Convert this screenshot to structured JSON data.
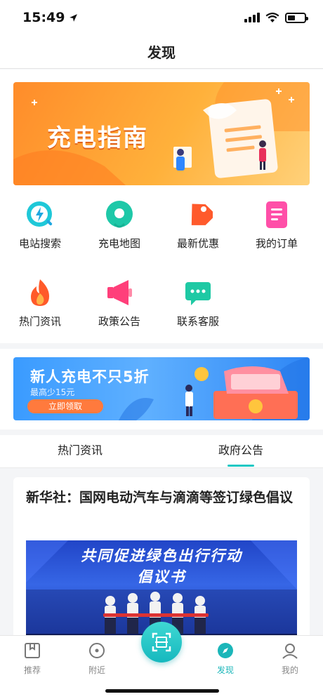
{
  "status_bar": {
    "time": "15:49"
  },
  "header": {
    "title": "发现"
  },
  "banner_top": {
    "title": "充电指南"
  },
  "grid": [
    {
      "label": "电站搜索",
      "icon": "lightning-search-icon",
      "color": "#1fc8d8"
    },
    {
      "label": "充电地图",
      "icon": "map-pin-icon",
      "color": "#1ec8a8"
    },
    {
      "label": "最新优惠",
      "icon": "price-tag-icon",
      "color": "#ff6a3d"
    },
    {
      "label": "我的订单",
      "icon": "order-list-icon",
      "color": "#ff4fa8"
    },
    {
      "label": "热门资讯",
      "icon": "flame-icon",
      "color": "#ff5a2a"
    },
    {
      "label": "政策公告",
      "icon": "megaphone-icon",
      "color": "#ff3f7a"
    },
    {
      "label": "联系客服",
      "icon": "chat-bubble-icon",
      "color": "#1ec9a4"
    }
  ],
  "promo": {
    "title": "新人充电不只5折",
    "subtitle": "最高少15元",
    "button": "立即领取"
  },
  "tabs": [
    {
      "label": "热门资讯"
    },
    {
      "label": "政府公告",
      "active": true
    }
  ],
  "news": [
    {
      "title": "新华社：国网电动汽车与滴滴等签订绿色倡议",
      "image_heading": "共同促进绿色出行行动",
      "image_subheading": "倡议书"
    }
  ],
  "tabbar": [
    {
      "label": "推荐",
      "icon": "book-icon"
    },
    {
      "label": "附近",
      "icon": "location-circle-icon"
    },
    {
      "label": "",
      "icon": "scan-icon"
    },
    {
      "label": "发现",
      "icon": "compass-icon",
      "active": true
    },
    {
      "label": "我的",
      "icon": "user-icon"
    }
  ],
  "colors": {
    "accent": "#1bb6b9",
    "banner_orange": "#ff9a2e",
    "promo_blue": "#3a9bff"
  }
}
